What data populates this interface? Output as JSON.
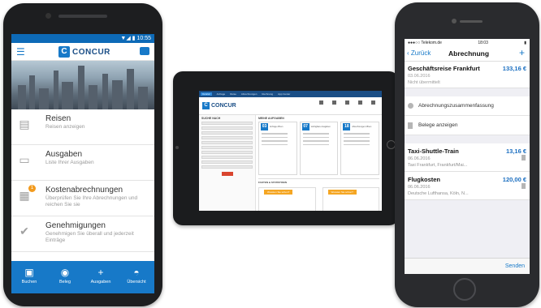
{
  "android": {
    "status_time": "▼◢ ▮ 10:55",
    "logo_letter": "C",
    "logo_text": "CONCUR",
    "menu_icon": "☰",
    "items": [
      {
        "icon": "briefcase-icon",
        "glyph": "▤",
        "title": "Reisen",
        "subtitle": "Reisen anzeigen"
      },
      {
        "icon": "card-icon",
        "glyph": "▭",
        "title": "Ausgaben",
        "subtitle": "Liste Ihrer Ausgaben"
      },
      {
        "icon": "report-icon",
        "glyph": "▦",
        "title": "Kostenabrechnungen",
        "subtitle": "Überprüfen Sie Ihre Abrechnungen und reichen Sie sie",
        "badge": "1"
      },
      {
        "icon": "check-icon",
        "glyph": "✔",
        "title": "Genehmigungen",
        "subtitle": "Genehmigen Sie überall und jederzeit Einträge"
      }
    ],
    "tabs": [
      {
        "icon": "suitcase-icon",
        "glyph": "▣",
        "label": "Buchen"
      },
      {
        "icon": "camera-icon",
        "glyph": "◉",
        "label": "Beleg"
      },
      {
        "icon": "plus-icon",
        "glyph": "+",
        "label": "Ausgaben"
      },
      {
        "icon": "gauge-icon",
        "glyph": "◓",
        "label": "Übersicht"
      }
    ]
  },
  "ipad": {
    "logo_letter": "C",
    "logo_text": "CONCUR",
    "top_tabs": [
      "Concur",
      "Anfrage",
      "Reise",
      "Abrechnungen",
      "Rechnung",
      "App Center"
    ],
    "left_title": "SUCHE NACH",
    "right_title": "MEINE AUFGABEN",
    "tasks": [
      {
        "num": "03",
        "label": "Anfrage öffnen"
      },
      {
        "num": "07",
        "label": "Verfügbare Ausgaben"
      },
      {
        "num": "18",
        "label": "Abrechnungen öffnen"
      }
    ],
    "stats_title": "FAKTEN & STATISTIKEN",
    "stat_tags": [
      "Wussten Sie schon?",
      "Wussten Sie schon?"
    ],
    "more": "•••"
  },
  "iphone": {
    "status_left": "●●●○○ Telekom.de",
    "status_time": "18:03",
    "status_right": "▮",
    "back_label": "‹ Zurück",
    "title": "Abrechnung",
    "plus": "+",
    "report": {
      "name": "Geschäftsreise Frankfurt",
      "amount": "133,16 €",
      "date": "03.06.2016",
      "status": "Nicht übermittelt"
    },
    "actions": [
      "Abrechnungszusammenfassung",
      "Belege anzeigen"
    ],
    "entries": [
      {
        "name": "Taxi-Shuttle-Train",
        "amount": "13,16 €",
        "date": "06.06.2016",
        "detail": "Taxi Frankfurt, Frankfurt/Mai..."
      },
      {
        "name": "Flugkosten",
        "amount": "120,00 €",
        "date": "06.06.2016",
        "detail": "Deutsche Lufthansa, Köln, N..."
      }
    ],
    "send_label": "Senden"
  }
}
